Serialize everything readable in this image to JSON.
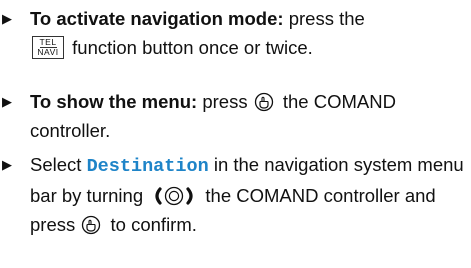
{
  "steps": [
    {
      "lead": "To activate navigation mode:",
      "a": " press the",
      "key_top": "TEL",
      "key_bottom": "NAVI",
      "b": " function button once or twice."
    },
    {
      "lead": "To show the menu:",
      "a": " press",
      "b": " the COMAND controller."
    },
    {
      "a": "Select",
      "mono": "Destination",
      "b": " in the navigation system menu bar by turning",
      "c": " the COMAND controller and press",
      "d": " to confirm."
    }
  ],
  "icons": {
    "bullet": "arrow-right-bullet-icon",
    "function_button": "tel-navi-button-icon",
    "press": "controller-press-icon",
    "turn": "controller-turn-icon"
  }
}
